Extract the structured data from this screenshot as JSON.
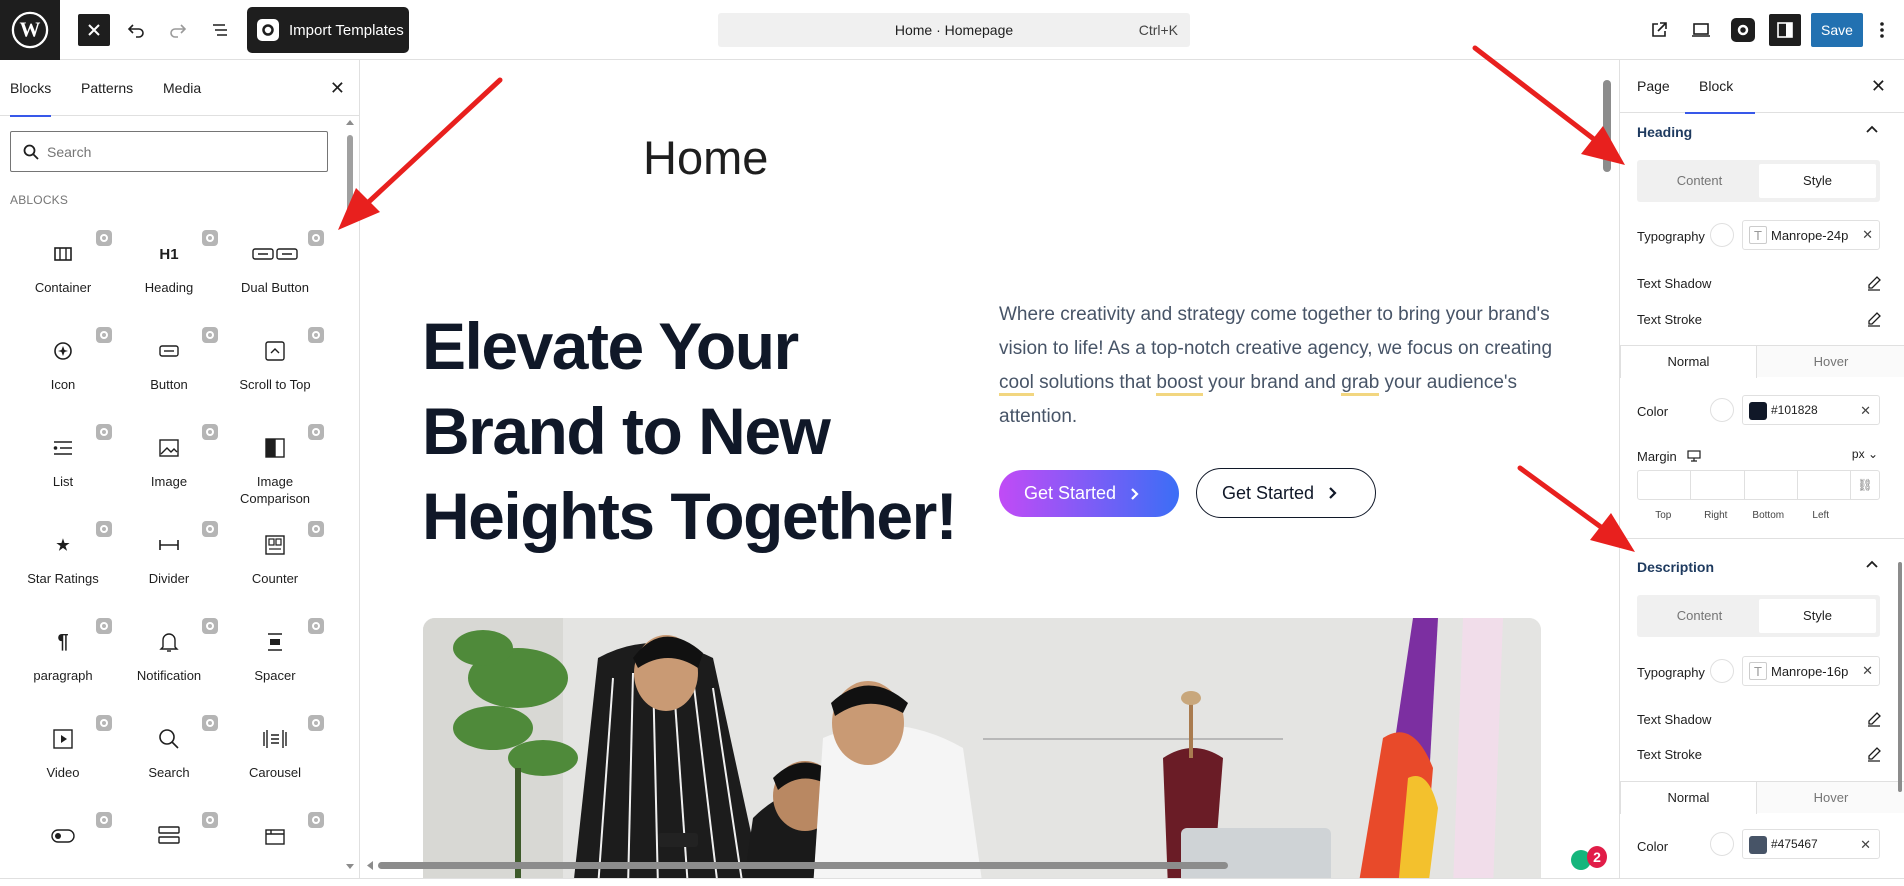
{
  "toolbar": {
    "import_label": "Import Templates",
    "document_title": "Home · Homepage",
    "shortcut": "Ctrl+K",
    "save_label": "Save"
  },
  "left_panel": {
    "tabs": [
      "Blocks",
      "Patterns",
      "Media"
    ],
    "search_placeholder": "Search",
    "section_label": "ABLOCKS",
    "blocks": [
      {
        "label": "Container",
        "icon": "container-icon"
      },
      {
        "label": "Heading",
        "icon": "heading-icon",
        "glyph": "H1"
      },
      {
        "label": "Dual Button",
        "icon": "dual-button-icon"
      },
      {
        "label": "Icon",
        "icon": "icon-block-icon"
      },
      {
        "label": "Button",
        "icon": "button-icon"
      },
      {
        "label": "Scroll to Top",
        "icon": "scroll-to-top-icon"
      },
      {
        "label": "List",
        "icon": "list-icon"
      },
      {
        "label": "Image",
        "icon": "image-icon"
      },
      {
        "label": "Image Comparison",
        "icon": "image-comparison-icon"
      },
      {
        "label": "Star Ratings",
        "icon": "star-ratings-icon"
      },
      {
        "label": "Divider",
        "icon": "divider-icon"
      },
      {
        "label": "Counter",
        "icon": "counter-icon"
      },
      {
        "label": "paragraph",
        "icon": "paragraph-icon",
        "glyph": "¶"
      },
      {
        "label": "Notification",
        "icon": "bell-icon"
      },
      {
        "label": "Spacer",
        "icon": "spacer-icon"
      },
      {
        "label": "Video",
        "icon": "video-icon"
      },
      {
        "label": "Search",
        "icon": "search-icon"
      },
      {
        "label": "Carousel",
        "icon": "carousel-icon"
      }
    ]
  },
  "canvas": {
    "page_title": "Home",
    "hero_heading": "Elevate Your Brand to New Heights Together!",
    "hero_text_parts": [
      "Where creativity and strategy come together to bring your brand's vision to life! As a top-notch creative agency, we focus on creating ",
      "cool",
      " solutions that ",
      "boost",
      " your brand and ",
      "grab",
      " your audience's attention."
    ],
    "primary_button": "Get Started",
    "secondary_button": "Get Started",
    "notification_count": "2"
  },
  "right_panel": {
    "tabs": [
      "Page",
      "Block"
    ],
    "heading_section": {
      "title": "Heading",
      "content_tab": "Content",
      "style_tab": "Style",
      "typography_label": "Typography",
      "typography_value": "Manrope-24p",
      "text_shadow_label": "Text Shadow",
      "text_stroke_label": "Text Stroke",
      "normal_tab": "Normal",
      "hover_tab": "Hover",
      "color_label": "Color",
      "color_value": "#101828",
      "margin_label": "Margin",
      "unit": "px",
      "margin_labels": [
        "Top",
        "Right",
        "Bottom",
        "Left"
      ]
    },
    "description_section": {
      "title": "Description",
      "content_tab": "Content",
      "style_tab": "Style",
      "typography_label": "Typography",
      "typography_value": "Manrope-16p",
      "text_shadow_label": "Text Shadow",
      "text_stroke_label": "Text Stroke",
      "normal_tab": "Normal",
      "hover_tab": "Hover",
      "color_label": "Color",
      "color_value": "#475467"
    }
  },
  "colors": {
    "accent": "#3858e9",
    "save": "#2271b1",
    "heading_color": "#101828",
    "description_color": "#475467",
    "arrow": "#e8201e"
  }
}
